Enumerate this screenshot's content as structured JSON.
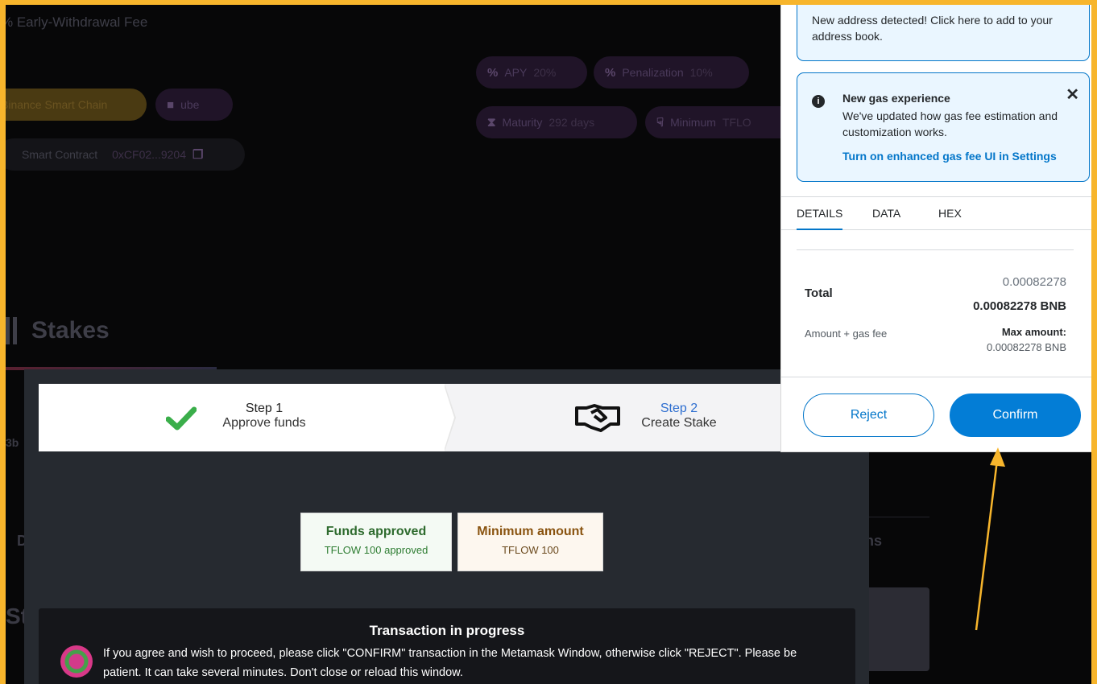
{
  "background": {
    "title": "% Early-Withdrawal Fee",
    "pills": {
      "chain": "Binance Smart Chain",
      "token": "ube",
      "contract_label": "Smart Contract",
      "contract_value": "0xCF02...9204",
      "apy_label": "APY",
      "apy_value": "20%",
      "penal_label": "Penalization",
      "penal_value": "10%",
      "maturity_label": "Maturity",
      "maturity_value": "292 days",
      "minimum_label": "Minimum",
      "minimum_value": "TFLO"
    },
    "stakes_title": "Stakes",
    "side_texts": [
      "3b",
      "D",
      "St",
      "ns"
    ]
  },
  "stepper": {
    "step1_title": "Step 1",
    "step1_sub": "Approve funds",
    "step2_title": "Step 2",
    "step2_sub": "Create Stake"
  },
  "badges": {
    "approved_title": "Funds approved",
    "approved_sub": "TFLOW 100 approved",
    "minimum_title": "Minimum amount",
    "minimum_sub": "TFLOW 100"
  },
  "progress": {
    "title": "Transaction in progress",
    "message": "If you agree and wish to proceed, please click \"CONFIRM\" transaction in the Metamask Window, otherwise click \"REJECT\". Please be patient. It can take several minutes. Don't close or reload this window."
  },
  "metamask": {
    "address_note": "New address detected! Click here to add to your address book.",
    "gas_head": "New gas experience",
    "gas_body": "We've updated how gas fee estimation and customization works.",
    "gas_link": "Turn on enhanced gas fee UI in Settings",
    "close": "✕",
    "tabs": [
      "DETAILS",
      "DATA",
      "HEX"
    ],
    "total_label": "Total",
    "total_value": "0.00082278",
    "total_bnb": "0.00082278 BNB",
    "sub_label": "Amount + gas fee",
    "max_label": "Max amount:",
    "max_value": "0.00082278 BNB",
    "reject": "Reject",
    "confirm": "Confirm",
    "accent": "#037dd6"
  },
  "annotation": {
    "color": "#f7b52c"
  }
}
